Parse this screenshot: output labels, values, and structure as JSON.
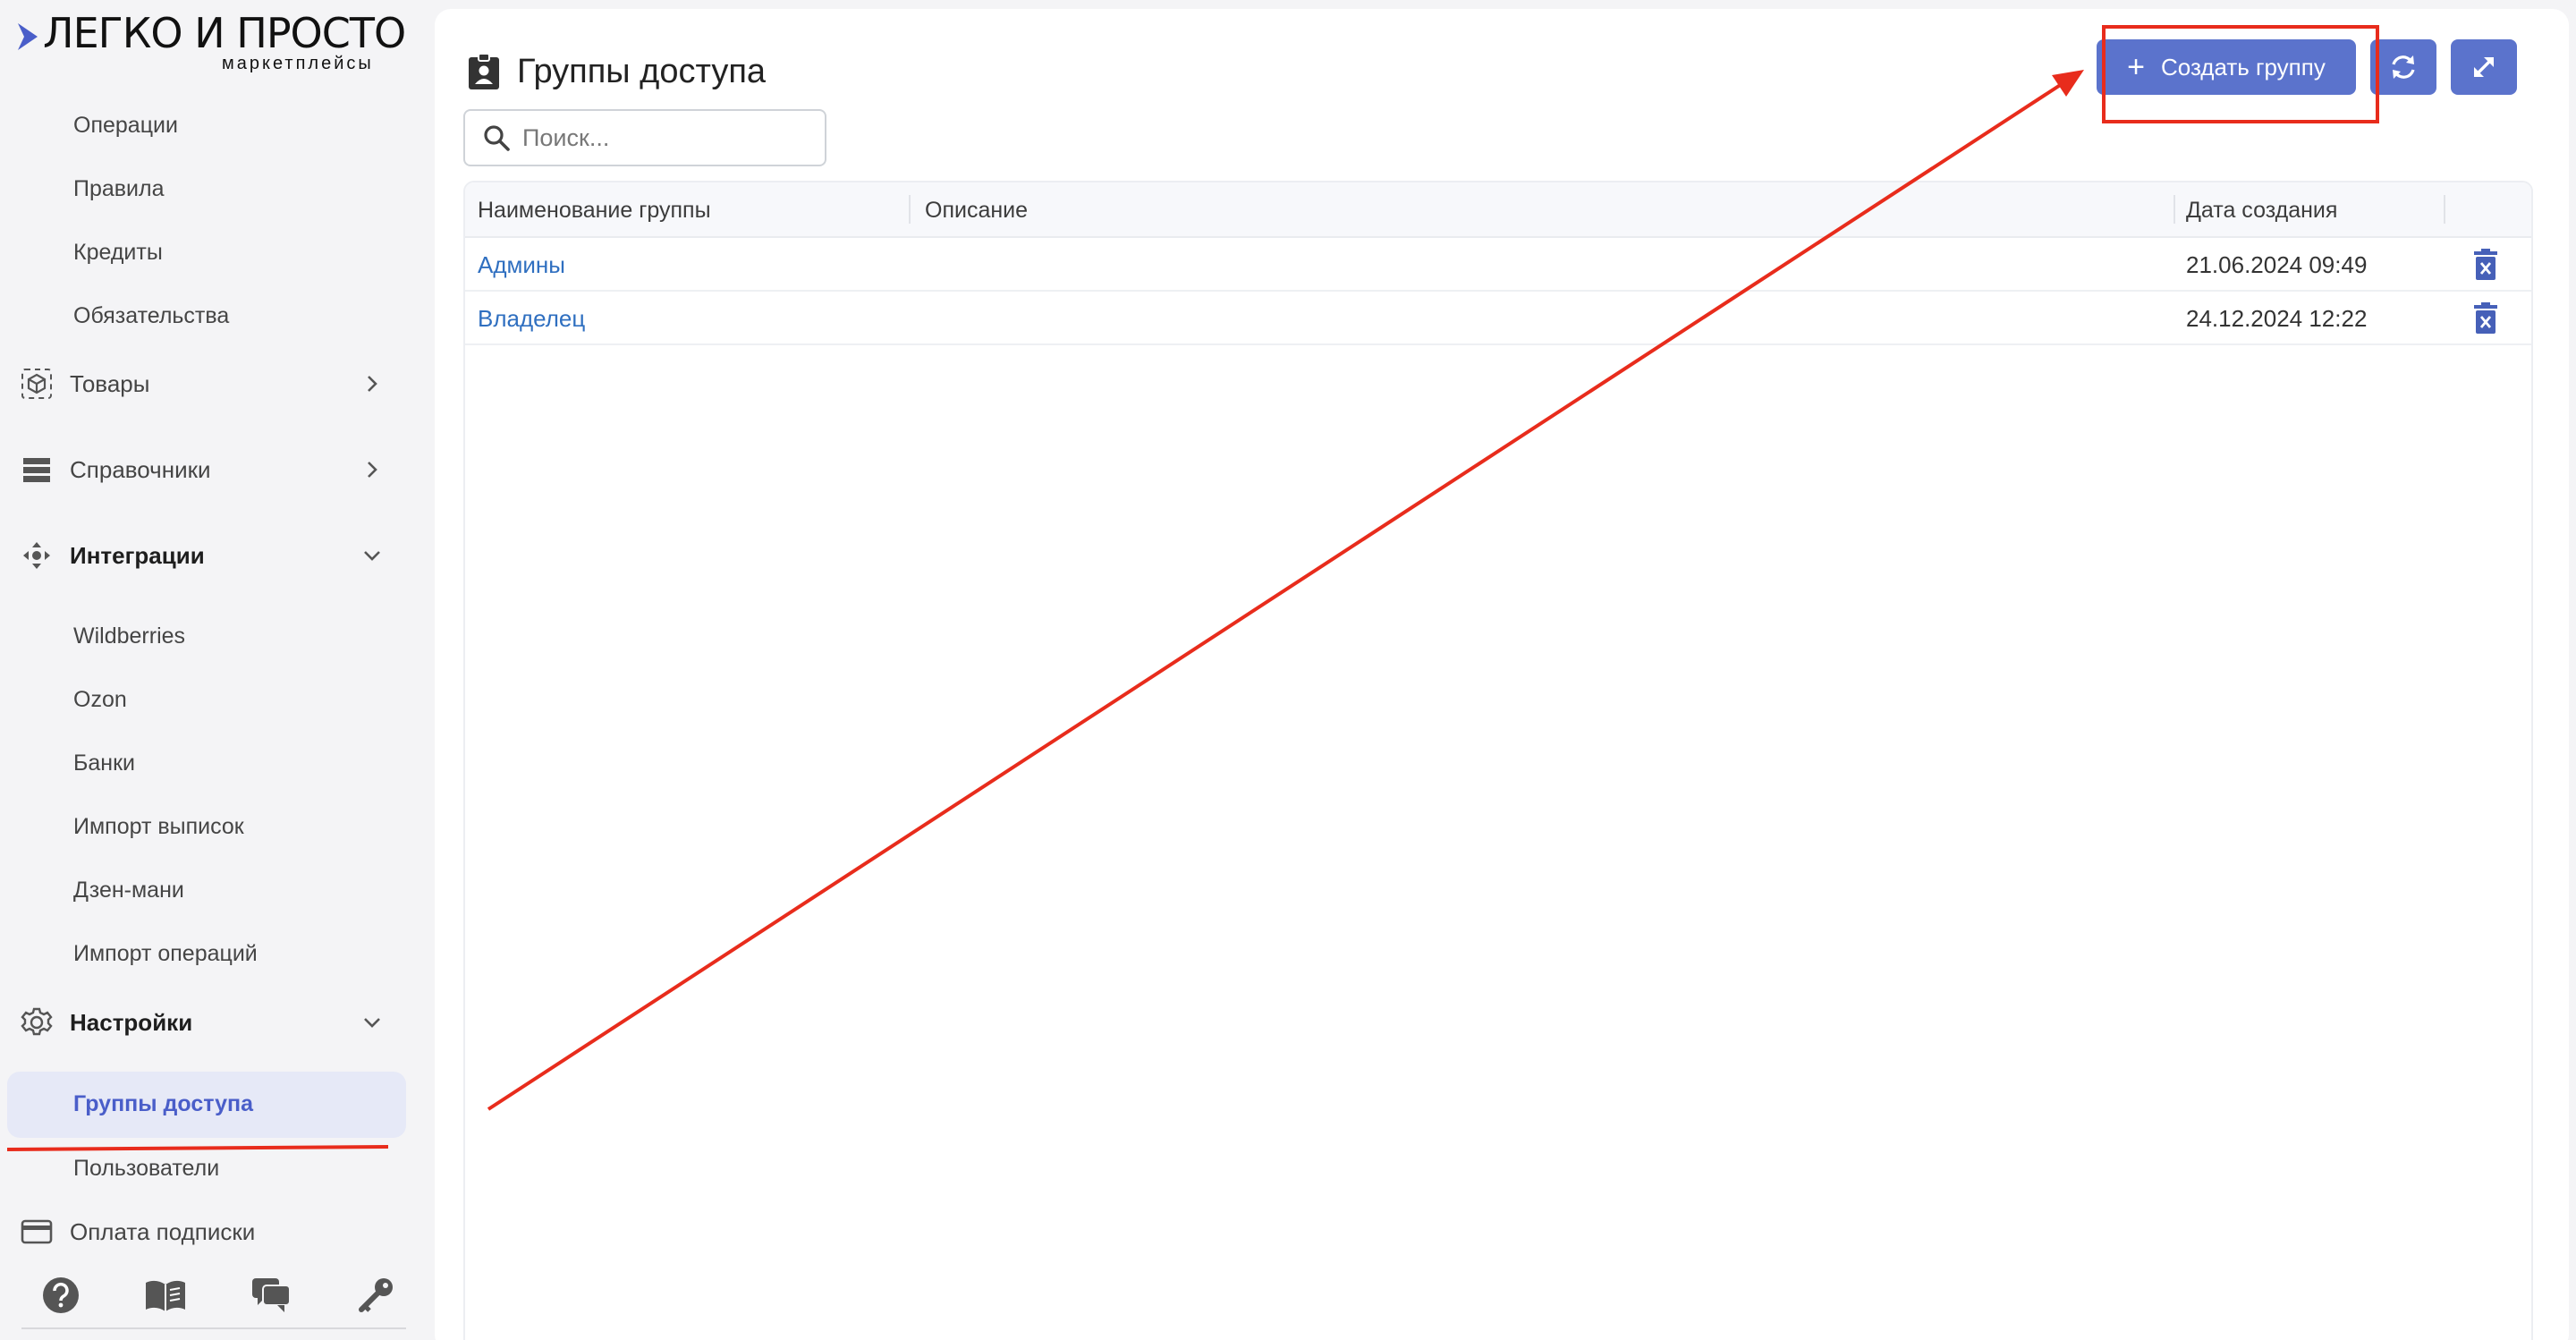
{
  "brand": {
    "title": "ЛЕГКО И ПРОСТО",
    "subtitle": "маркетплейсы",
    "accent": "#4a5ec9"
  },
  "sidebar": {
    "sub_items_top": [
      {
        "label": "Операции"
      },
      {
        "label": "Правила"
      },
      {
        "label": "Кредиты"
      },
      {
        "label": "Обязательства"
      }
    ],
    "groups": {
      "products": {
        "label": "Товары",
        "icon": "box-icon"
      },
      "dictionaries": {
        "label": "Справочники",
        "icon": "list-icon"
      },
      "integrations": {
        "label": "Интеграции",
        "icon": "integration-icon"
      },
      "settings": {
        "label": "Настройки",
        "icon": "gear-icon"
      },
      "subscription": {
        "label": "Оплата подписки",
        "icon": "credit-card-icon"
      }
    },
    "integration_items": [
      {
        "label": "Wildberries"
      },
      {
        "label": "Ozon"
      },
      {
        "label": "Банки"
      },
      {
        "label": "Импорт выписок"
      },
      {
        "label": "Дзен-мани"
      },
      {
        "label": "Импорт операций"
      }
    ],
    "settings_items": [
      {
        "label": "Группы доступа",
        "active": true
      },
      {
        "label": "Пользователи"
      }
    ],
    "bottom_icons": [
      "help-icon",
      "book-icon",
      "chat-icon",
      "key-icon"
    ]
  },
  "main": {
    "title": "Группы доступа",
    "create_button": "Создать группу",
    "search_placeholder": "Поиск...",
    "columns": [
      "Наименование группы",
      "Описание",
      "Дата создания"
    ],
    "rows": [
      {
        "name": "Админы",
        "description": "",
        "created": "21.06.2024 09:49"
      },
      {
        "name": "Владелец",
        "description": "",
        "created": "24.12.2024 12:22"
      }
    ],
    "button_color": "#5b73cc",
    "link_color": "#2f6fc0"
  },
  "annotations": {
    "color": "#e82c1c"
  }
}
